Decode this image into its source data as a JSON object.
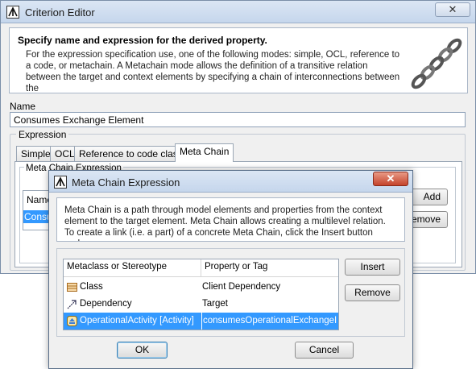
{
  "window": {
    "title": "Criterion Editor",
    "close_glyph": "✕"
  },
  "header": {
    "title": "Specify name and expression for the derived property.",
    "description": "For the expression specification use, one of the following modes: simple, OCL, reference to a code, or metachain. A Metachain mode allows the definition of a transitive relation between the target and context elements by specifying a chain of interconnections between the",
    "image_icon": "chain-links-icon"
  },
  "name": {
    "label": "Name",
    "value": "Consumes Exchange Element"
  },
  "expression": {
    "label": "Expression",
    "tabs": [
      "Simple",
      "OCL",
      "Reference to code class",
      "Meta Chain"
    ],
    "active_tab": "Meta Chain",
    "group_label": "Meta Chain Expression",
    "bg_table_header": "Name",
    "bg_table_selected": "Consumes",
    "bg_buttons": [
      "Add",
      "Remove"
    ]
  },
  "dialog": {
    "title": "Meta Chain Expression",
    "close_glyph": "✕",
    "description": "Meta Chain is a path through model elements and properties from the context element to the target element. Meta Chain allows creating a multilevel relation. To create a link (i.e. a part) of a concrete Meta Chain, click the Insert button and",
    "table": {
      "headers": [
        "Metaclass or Stereotype",
        "Property or Tag"
      ],
      "rows": [
        {
          "metaclass": "Class",
          "property": "Client Dependency",
          "icon": "class-icon",
          "selected": false
        },
        {
          "metaclass": "Dependency",
          "property": "Target",
          "icon": "dependency-arrow-icon",
          "selected": false
        },
        {
          "metaclass": "OperationalActivity [Activity]",
          "property": "consumesOperationalExchangeI...",
          "icon": "operational-activity-icon",
          "selected": true
        }
      ]
    },
    "buttons": {
      "insert": "Insert",
      "remove": "Remove",
      "ok": "OK",
      "cancel": "Cancel"
    }
  },
  "colors": {
    "selection": "#3399ff",
    "titlebar": "#c5d6ec",
    "close_red": "#c4432b"
  }
}
